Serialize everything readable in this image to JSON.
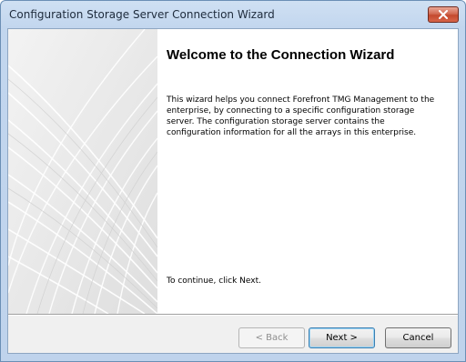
{
  "window": {
    "title": "Configuration Storage Server Connection Wizard"
  },
  "content": {
    "heading": "Welcome to the Connection Wizard",
    "description": "This wizard helps you connect Forefront TMG Management to the enterprise, by connecting to a specific configuration storage server. The configuration storage server contains the configuration information for all the arrays in this enterprise.",
    "continue_text": "To continue, click Next."
  },
  "buttons": {
    "back": "< Back",
    "next": "Next >",
    "cancel": "Cancel"
  },
  "icons": {
    "close": "close-icon"
  },
  "colors": {
    "title_bar": "#c2d6ee",
    "close_button": "#c44a2e",
    "panel_bg": "#ebebeb",
    "content_bg": "#ffffff"
  },
  "state": {
    "back_enabled": false,
    "default_button": "next"
  }
}
